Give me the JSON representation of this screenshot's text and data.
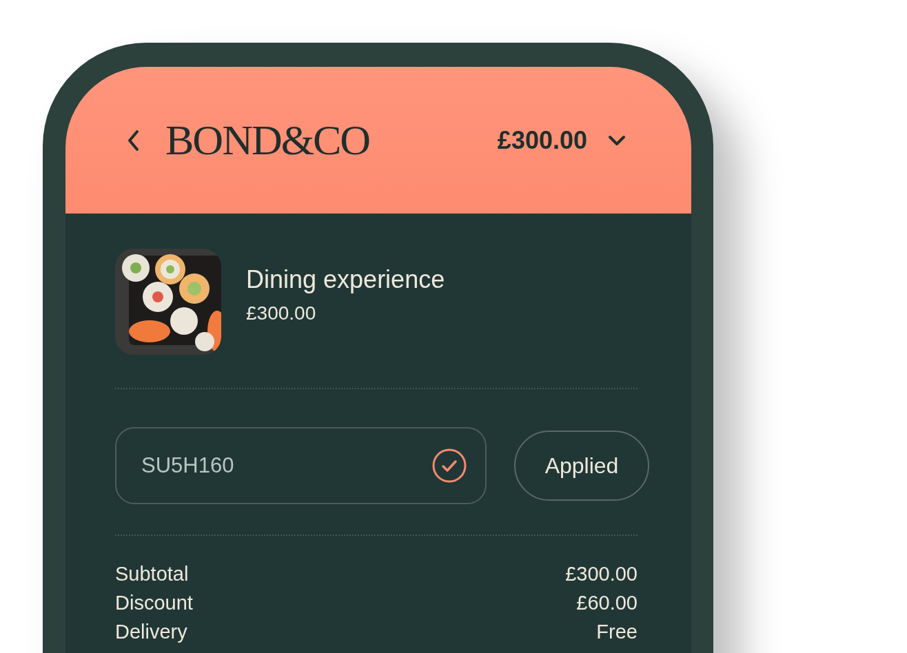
{
  "header": {
    "brand": "BOND&CO",
    "total": "£300.00"
  },
  "item": {
    "title": "Dining experience",
    "price": "£300.00"
  },
  "promo": {
    "value": "SU5H160",
    "valid": true,
    "button": "Applied"
  },
  "summary": [
    {
      "label": "Subtotal",
      "value": "£300.00"
    },
    {
      "label": "Discount",
      "value": "£60.00"
    },
    {
      "label": "Delivery",
      "value": "Free"
    }
  ]
}
